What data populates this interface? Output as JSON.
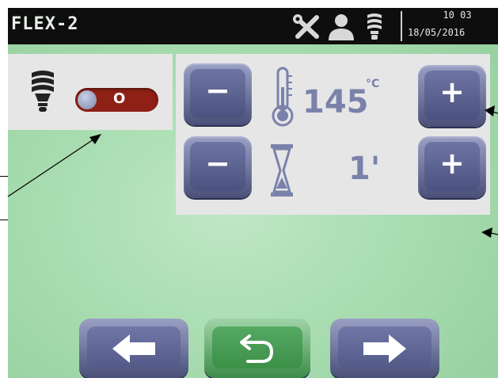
{
  "header": {
    "title": "FLEX-2",
    "time": "10 03",
    "date": "18/05/2016",
    "icons": [
      "tools-icon",
      "user-icon",
      "lamp-icon"
    ]
  },
  "lamp_panel": {
    "icon": "lamp-icon",
    "toggle_label": "O",
    "toggle_color": "#8e2016"
  },
  "settings": {
    "temperature": {
      "icon": "thermometer-icon",
      "value": "145",
      "unit": "°C"
    },
    "time": {
      "icon": "hourglass-icon",
      "value": "1'"
    },
    "minus_label": "−",
    "plus_label": "+"
  },
  "navigation": {
    "prev_icon": "arrow-left-icon",
    "back_icon": "return-icon",
    "next_icon": "arrow-right-icon"
  },
  "colors": {
    "screen_bg": "#a9ddb1",
    "header_bg": "#0e0e0e",
    "button": "#5b6190",
    "back_button": "#3b8f47"
  }
}
